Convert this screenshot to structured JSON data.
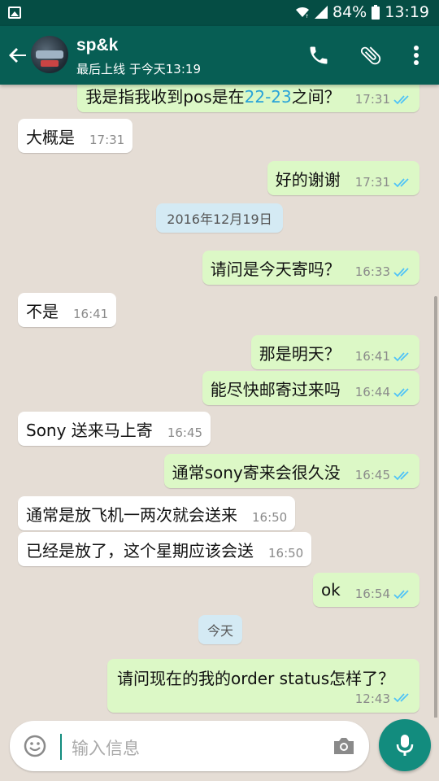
{
  "status_bar": {
    "battery": "84%",
    "time": "13:19"
  },
  "header": {
    "contact_name": "sp&k",
    "last_seen": "最后上线 于今天13:19"
  },
  "colors": {
    "header": "#075e54",
    "status_bar": "#054d44",
    "outgoing": "#dcf8c6",
    "incoming": "#ffffff",
    "ticks": "#4fc3f7",
    "accent": "#128c7e"
  },
  "messages": [
    {
      "dir": "out",
      "text_before": "我是指我收到pos是在",
      "text_highlight": "22-23",
      "text_after": "之间？",
      "time": "17:31",
      "read": true
    },
    {
      "dir": "in",
      "text": "大概是",
      "time": "17:31"
    },
    {
      "dir": "out",
      "text": "好的谢谢",
      "time": "17:31",
      "read": true
    },
    {
      "type": "date",
      "text": "2016年12月19日"
    },
    {
      "dir": "out",
      "text": "请问是今天寄吗？",
      "time": "16:33",
      "read": true
    },
    {
      "dir": "in",
      "text": "不是",
      "time": "16:41"
    },
    {
      "dir": "out",
      "text": "那是明天？",
      "time": "16:41",
      "read": true
    },
    {
      "dir": "out",
      "text": "能尽快邮寄过来吗",
      "time": "16:44",
      "read": true
    },
    {
      "dir": "in",
      "text": "Sony 送来马上寄",
      "time": "16:45"
    },
    {
      "dir": "out",
      "text": "通常sony寄来会很久没",
      "time": "16:45",
      "read": true
    },
    {
      "dir": "in",
      "text": "通常是放飞机一两次就会送来",
      "time": "16:50"
    },
    {
      "dir": "in",
      "text": "已经是放了，这个星期应该会送",
      "time": "16:50"
    },
    {
      "dir": "out",
      "text": "ok",
      "time": "16:54",
      "read": true
    },
    {
      "type": "date",
      "text": "今天"
    },
    {
      "dir": "out",
      "text": "请问现在的我的order status怎样了？",
      "time": "12:43",
      "read": true
    }
  ],
  "composer": {
    "placeholder": "输入信息"
  },
  "icons": [
    "image-icon",
    "wifi-icon",
    "signal-icon",
    "battery-icon",
    "back-arrow-icon",
    "phone-icon",
    "attach-icon",
    "more-vert-icon",
    "double-tick-icon",
    "emoji-icon",
    "camera-icon",
    "mic-icon"
  ]
}
